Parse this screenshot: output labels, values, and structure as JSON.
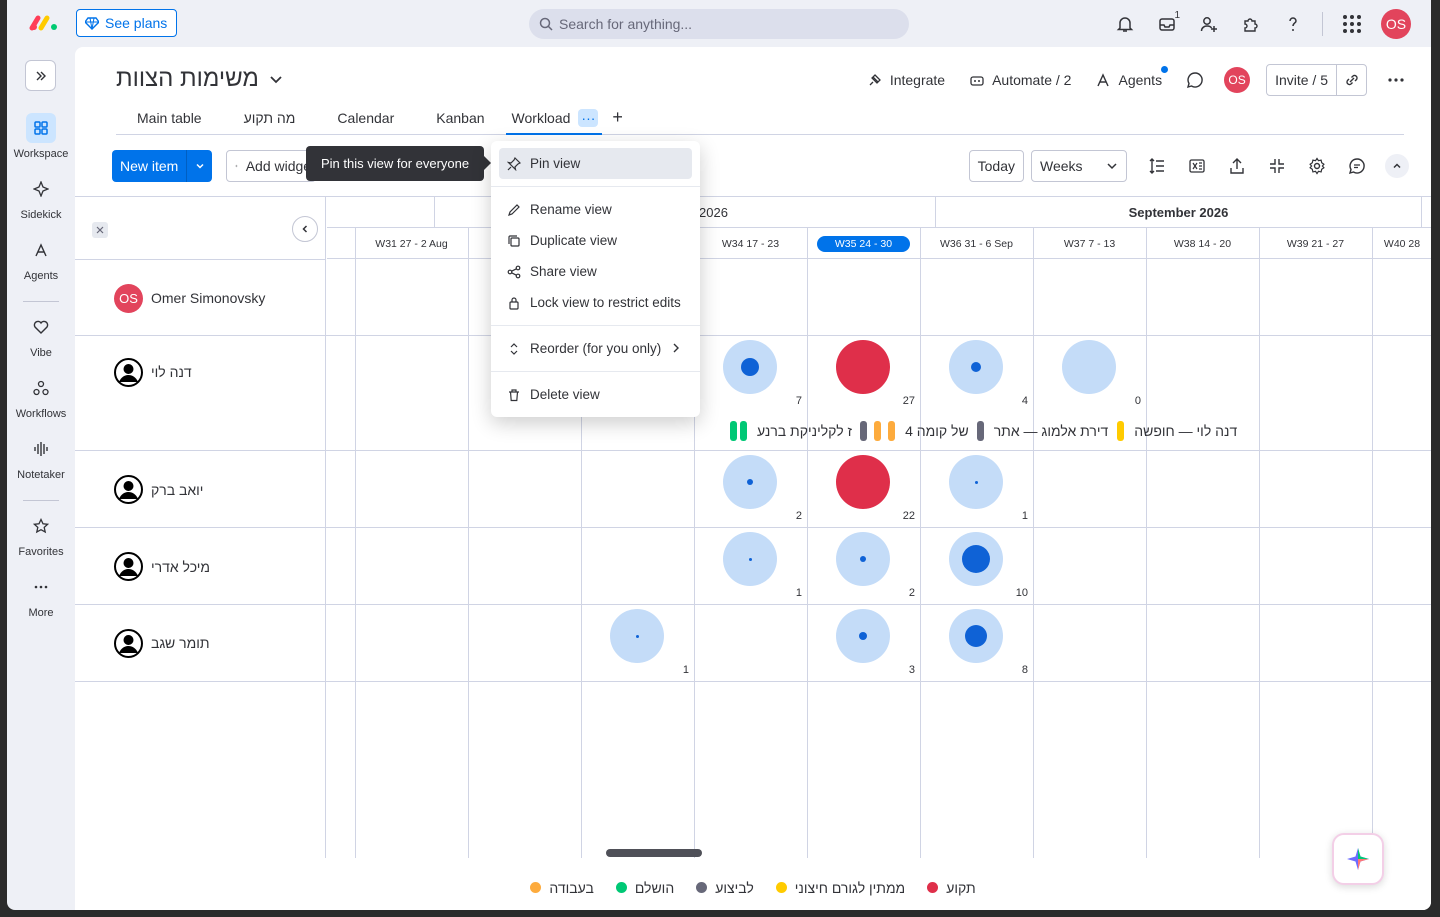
{
  "topbar": {
    "see_plans": "See plans",
    "search_placeholder": "Search for anything...",
    "inbox_badge": "1",
    "user_initials": "OS"
  },
  "rail": {
    "items": [
      {
        "label": "Workspace",
        "icon": "grid-icon"
      },
      {
        "label": "Sidekick",
        "icon": "sparkle-icon"
      },
      {
        "label": "Agents",
        "icon": "agents-icon"
      },
      {
        "label": "Vibe",
        "icon": "heart-icon"
      },
      {
        "label": "Workflows",
        "icon": "workflows-icon"
      },
      {
        "label": "Notetaker",
        "icon": "waveform-icon"
      },
      {
        "label": "Favorites",
        "icon": "star-icon"
      },
      {
        "label": "More",
        "icon": "more-icon"
      }
    ]
  },
  "board": {
    "title": "משימות הצוות",
    "integrate": "Integrate",
    "automate": "Automate / 2",
    "agents": "Agents",
    "invite": "Invite / 5",
    "user_initials": "OS"
  },
  "tabs": [
    "Main table",
    "מה תקוע",
    "Calendar",
    "Kanban",
    "Workload"
  ],
  "toolbar": {
    "new_item": "New item",
    "add_widget": "Add widget",
    "today": "Today",
    "weeks": "Weeks"
  },
  "tooltip": "Pin this view for everyone",
  "view_menu": {
    "pin": "Pin view",
    "rename": "Rename view",
    "duplicate": "Duplicate view",
    "share": "Share view",
    "lock": "Lock view to restrict edits",
    "reorder": "Reorder (for you only)",
    "delete": "Delete view"
  },
  "timeline": {
    "months": [
      "2026",
      "September 2026"
    ],
    "weeks": [
      "W31 27 - 2 Aug",
      "W34 17 - 23",
      "W35 24 - 30",
      "W36 31 - 6 Sep",
      "W37 7 - 13",
      "W38 14 - 20",
      "W39 21 - 27",
      "W40 28"
    ]
  },
  "people": [
    {
      "name": "Omer Simonovsky",
      "initials": "OS"
    },
    {
      "name": "דנה לוי"
    },
    {
      "name": "יואב ברק"
    },
    {
      "name": "מיכל אדרי"
    },
    {
      "name": "תומר שגב"
    }
  ],
  "workload": {
    "dana": [
      "7",
      "27",
      "4",
      "0"
    ],
    "yoav": [
      "2",
      "22",
      "1"
    ],
    "michal": [
      "1",
      "2",
      "10"
    ],
    "tomer": [
      "1",
      "3",
      "8"
    ]
  },
  "task_strip": {
    "t1": "ז לקליניקת ברנע",
    "t2": "4 של קומה",
    "t3": "דירת אלמוג — אתר",
    "t4": "דנה לוי — חופשה"
  },
  "legend": [
    {
      "label": "בעבודה",
      "color": "#fdab3d"
    },
    {
      "label": "הושלם",
      "color": "#00c875"
    },
    {
      "label": "לביצוע",
      "color": "#676879"
    },
    {
      "label": "ממתין לגורם חיצוני",
      "color": "#ffcb00"
    },
    {
      "label": "תקוע",
      "color": "#df2f4a"
    }
  ],
  "colors": {
    "accent": "#0073ea",
    "stuck": "#df2f4a",
    "bubble": "#c4dcf8",
    "bubble_inner": "#0f62d6"
  }
}
